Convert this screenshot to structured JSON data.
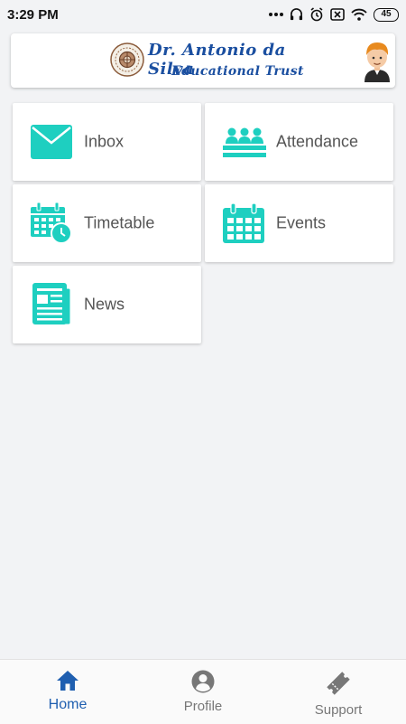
{
  "status_bar": {
    "time": "3:29 PM",
    "battery": "45"
  },
  "header": {
    "brand_line1": "Dr. Antonio da Silva",
    "brand_line2": "Educational Trust"
  },
  "tiles": [
    {
      "label": "Inbox",
      "icon": "envelope-icon"
    },
    {
      "label": "Attendance",
      "icon": "group-icon"
    },
    {
      "label": "Timetable",
      "icon": "calendar-clock-icon"
    },
    {
      "label": "Events",
      "icon": "calendar-icon"
    },
    {
      "label": "News",
      "icon": "newspaper-icon"
    }
  ],
  "bottom_nav": [
    {
      "label": "Home",
      "icon": "home-icon",
      "active": true
    },
    {
      "label": "Profile",
      "icon": "account-circle-icon",
      "active": false
    },
    {
      "label": "Support",
      "icon": "ticket-icon",
      "active": false
    }
  ],
  "colors": {
    "accent_teal": "#1ecfc0",
    "nav_active": "#1f5fb0",
    "brand_blue": "#1b4fa0"
  }
}
